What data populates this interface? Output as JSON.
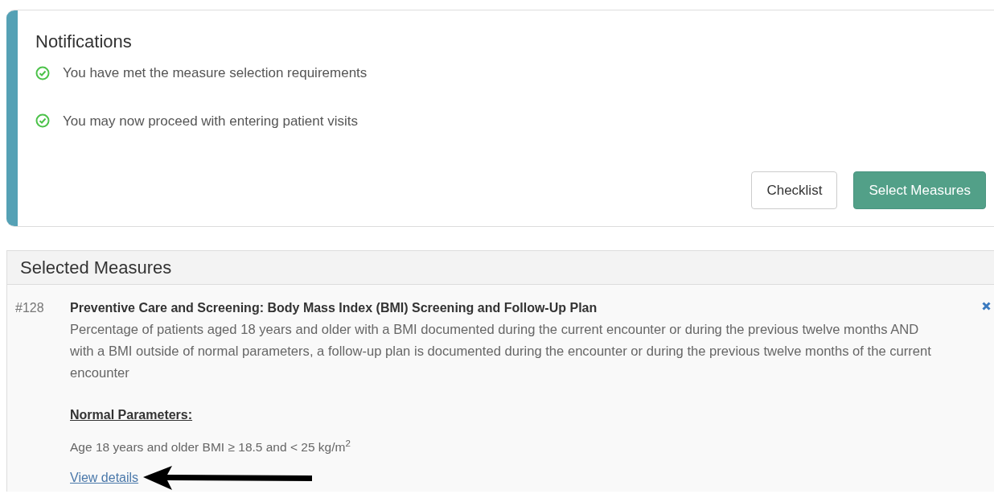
{
  "notifications": {
    "title": "Notifications",
    "items": [
      {
        "kind": "success",
        "text": "You have met the measure selection requirements"
      },
      {
        "kind": "success",
        "text": "You may now proceed with entering patient visits"
      }
    ],
    "buttons": [
      {
        "kind": "default",
        "label": "Checklist"
      },
      {
        "kind": "primary",
        "label": "Select Measures"
      }
    ]
  },
  "selected_measures": {
    "title": "Selected Measures",
    "measures": [
      {
        "number": "#128",
        "title": "Preventive Care and Screening: Body Mass Index (BMI) Screening and Follow-Up Plan",
        "description": "Percentage of patients aged 18 years and older with a BMI documented during the current encounter or during the previous twelve months AND with a BMI outside of normal parameters, a follow-up plan is documented during the encounter or during the previous twelve months of the current encounter",
        "parameters_heading": "Normal Parameters:",
        "parameters": "Age 18 years and older BMI ≥ 18.5 and < 25 kg/m$^{2}$",
        "link": "View details",
        "annotated": true
      }
    ]
  }
}
